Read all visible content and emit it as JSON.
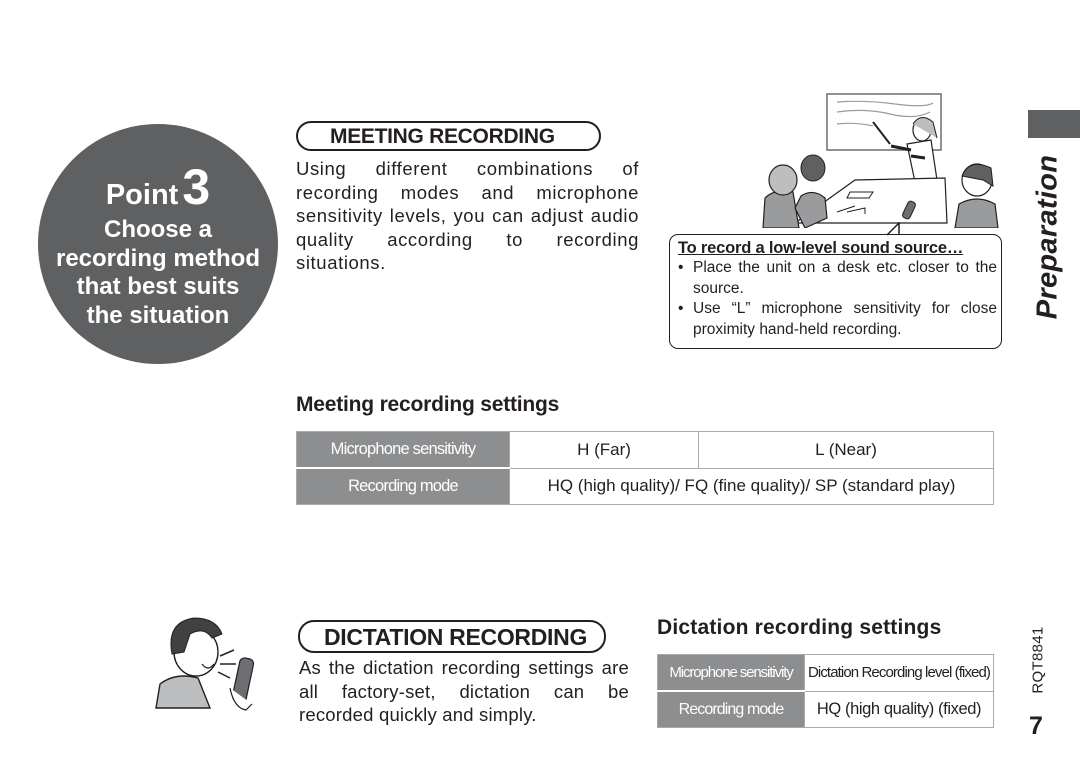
{
  "point": {
    "word": "Point",
    "number": "3",
    "lines": [
      "Choose a",
      "recording method",
      "that best suits",
      "the situation"
    ]
  },
  "meeting": {
    "title": "MEETING RECORDING",
    "description": "Using different combinations of recording modes and microphone sensitivity levels, you can adjust audio quality according to recording situations.",
    "illustration_icon": "meeting-room-illustration",
    "callout": {
      "title": "To record a low-level sound source…",
      "bullet": "•",
      "items": [
        "Place the unit on a desk etc. closer to the source.",
        "Use “L” microphone sensitivity for close proximity hand-held recording."
      ]
    },
    "settings": {
      "heading": "Meeting recording settings",
      "rows": [
        {
          "label": "Microphone sensitivity",
          "values": [
            "H (Far)",
            "L (Near)"
          ]
        },
        {
          "label": "Recording mode",
          "values": [
            "HQ (high quality)/ FQ (fine quality)/ SP (standard play)"
          ]
        }
      ]
    }
  },
  "dictation": {
    "title": "DICTATION RECORDING",
    "description": "As the dictation recording settings are all factory-set, dictation can be recorded quickly and simply.",
    "illustration_icon": "person-dictating-illustration",
    "settings": {
      "heading": "Dictation recording settings",
      "rows": [
        {
          "label": "Microphone sensitivity",
          "value": "Dictation Recording level (fixed)"
        },
        {
          "label": "Recording mode",
          "value": "HQ (high quality) (fixed)"
        }
      ]
    }
  },
  "sidebar": {
    "section_label": "Preparation",
    "doc_code": "RQT8841",
    "page_number": "7"
  },
  "colors": {
    "dark_gray": "#5f6062",
    "table_header_gray": "#8d8e90",
    "table_border": "#a7a9ac",
    "text": "#231f20"
  }
}
